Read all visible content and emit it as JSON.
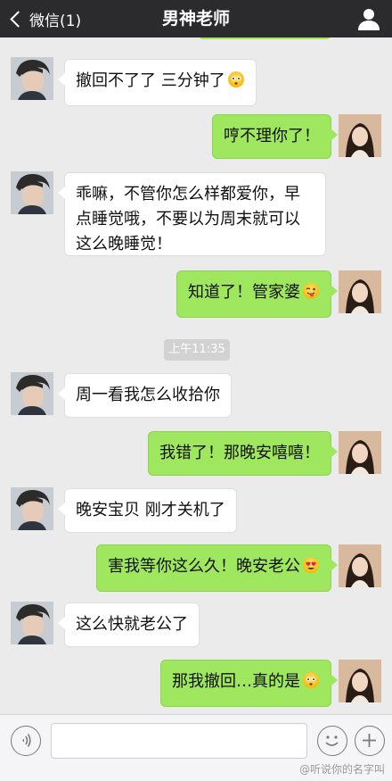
{
  "header": {
    "back_label": "微信(1)",
    "title": "男神老师"
  },
  "timestamp": "上午11:35",
  "messages": [
    {
      "side": "left",
      "text": "撤回不了了 三分钟了",
      "emoji": "worried-face"
    },
    {
      "side": "right",
      "text": "哼不理你了！"
    },
    {
      "side": "left",
      "text": "乖嘛，不管你怎么样都爱你，早点睡觉哦，不要以为周末就可以这么晚睡觉！"
    },
    {
      "side": "right",
      "text": "知道了！管家婆",
      "emoji": "winking-tongue-face"
    },
    {
      "side": "left",
      "text": "周一看我怎么收拾你"
    },
    {
      "side": "right",
      "text": "我错了！那晚安嘻嘻！"
    },
    {
      "side": "left",
      "text": "晚安宝贝 刚才关机了"
    },
    {
      "side": "right",
      "text": "害我等你这么久！晚安老公",
      "emoji": "heart-eyes-face"
    },
    {
      "side": "left",
      "text": "这么快就老公了"
    },
    {
      "side": "right",
      "text": "那我撤回…真的是",
      "emoji": "worried-face"
    }
  ],
  "input": {
    "voice_icon": "voice-icon",
    "emoji_icon": "emoji-icon",
    "plus_icon": "plus-icon"
  },
  "watermark": "@听说你的名字叫",
  "colors": {
    "header_bg": "#2b2b2d",
    "chat_bg": "#ebebeb",
    "bubble_right": "#9fe75f",
    "bubble_left": "#ffffff"
  }
}
